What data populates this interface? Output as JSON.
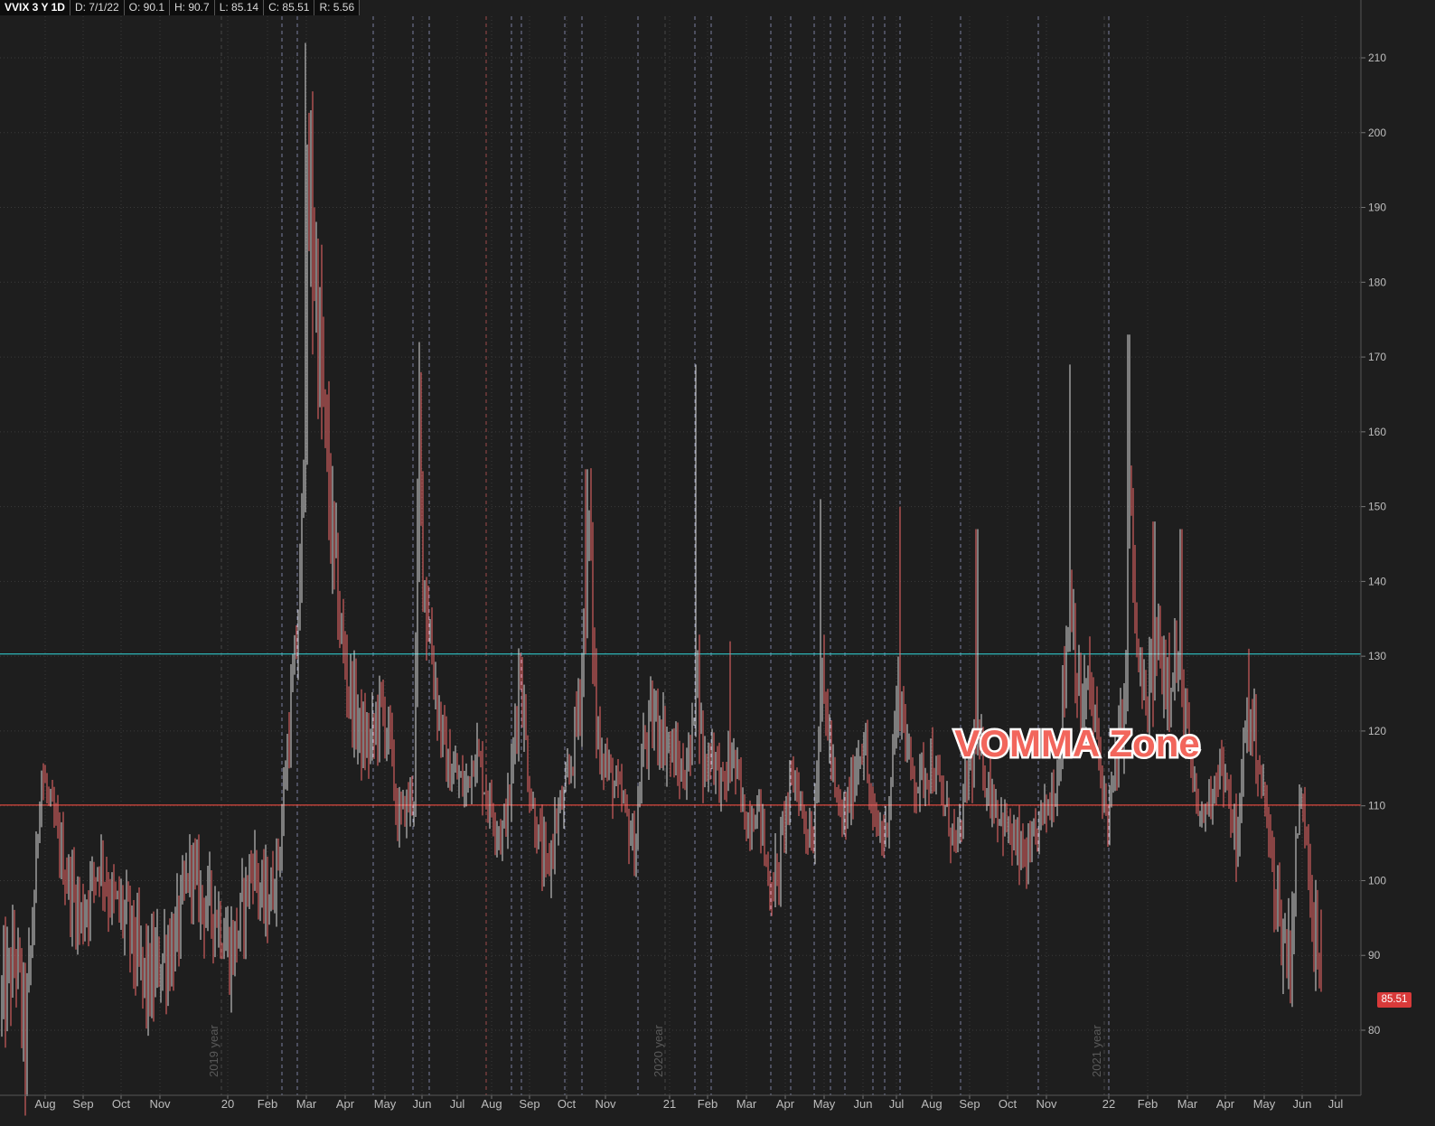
{
  "header": {
    "symbol": "VVIX 3 Y 1D",
    "date": "D: 7/1/22",
    "open": "O: 90.1",
    "high": "H: 90.7",
    "low": "L: 85.14",
    "close": "C: 85.51",
    "range": "R: 5.56"
  },
  "price_tag": "85.51",
  "annotation": "VOMMA Zone",
  "colors": {
    "background": "#1e1e1e",
    "down_candle": "#f46b6b",
    "up_candle": "#dcdcdc",
    "upper_line": "#2fc4c8",
    "lower_line": "#d9483f",
    "annotation_fill": "#f2665c",
    "annotation_outline": "#ffffff"
  },
  "chart_data": {
    "type": "candlestick",
    "title": "VVIX 3 Y 1D",
    "ylim": [
      72,
      215
    ],
    "yticks": [
      80,
      90,
      100,
      110,
      120,
      130,
      140,
      150,
      160,
      170,
      180,
      190,
      200,
      210
    ],
    "x_tick_labels": [
      "Aug",
      "Sep",
      "Oct",
      "Nov",
      "20",
      "Feb",
      "Mar",
      "Apr",
      "May",
      "Jun",
      "Jul",
      "Aug",
      "Sep",
      "Oct",
      "Nov",
      "21",
      "Feb",
      "Mar",
      "Apr",
      "May",
      "Jun",
      "Jul",
      "Aug",
      "Sep",
      "Oct",
      "Nov",
      "22",
      "Feb",
      "Mar",
      "Apr",
      "May",
      "Jun",
      "Jul"
    ],
    "year_labels": [
      "2019 year",
      "2020 year",
      "2021 year"
    ],
    "horizontal_lines": [
      {
        "value": 130.3,
        "color": "#2fc4c8"
      },
      {
        "value": 110.1,
        "color": "#d9483f"
      }
    ],
    "grid": true,
    "last_close": 85.51,
    "series_anchor_points": [
      [
        0,
        83
      ],
      [
        18,
        90
      ],
      [
        28,
        78
      ],
      [
        40,
        102
      ],
      [
        45,
        115
      ],
      [
        55,
        110
      ],
      [
        65,
        105
      ],
      [
        75,
        100
      ],
      [
        90,
        95
      ],
      [
        110,
        103
      ],
      [
        125,
        97
      ],
      [
        140,
        95
      ],
      [
        155,
        88
      ],
      [
        165,
        86
      ],
      [
        180,
        90
      ],
      [
        195,
        92
      ],
      [
        210,
        102
      ],
      [
        225,
        97
      ],
      [
        240,
        96
      ],
      [
        255,
        90
      ],
      [
        265,
        94
      ],
      [
        280,
        103
      ],
      [
        290,
        97
      ],
      [
        300,
        98
      ],
      [
        310,
        105
      ],
      [
        318,
        118
      ],
      [
        326,
        128
      ],
      [
        333,
        140
      ],
      [
        338,
        175
      ],
      [
        343,
        190
      ],
      [
        348,
        184
      ],
      [
        355,
        168
      ],
      [
        362,
        155
      ],
      [
        370,
        142
      ],
      [
        380,
        130
      ],
      [
        390,
        124
      ],
      [
        400,
        119
      ],
      [
        410,
        118
      ],
      [
        420,
        123
      ],
      [
        430,
        120
      ],
      [
        440,
        108
      ],
      [
        450,
        110
      ],
      [
        458,
        112
      ],
      [
        464,
        158
      ],
      [
        470,
        140
      ],
      [
        478,
        130
      ],
      [
        486,
        122
      ],
      [
        495,
        115
      ],
      [
        505,
        114
      ],
      [
        515,
        112
      ],
      [
        525,
        118
      ],
      [
        540,
        111
      ],
      [
        555,
        106
      ],
      [
        565,
        112
      ],
      [
        575,
        130
      ],
      [
        585,
        113
      ],
      [
        595,
        106
      ],
      [
        605,
        100
      ],
      [
        615,
        108
      ],
      [
        625,
        111
      ],
      [
        635,
        118
      ],
      [
        645,
        130
      ],
      [
        652,
        148
      ],
      [
        660,
        120
      ],
      [
        675,
        114
      ],
      [
        690,
        110
      ],
      [
        702,
        104
      ],
      [
        712,
        118
      ],
      [
        725,
        122
      ],
      [
        740,
        118
      ],
      [
        755,
        114
      ],
      [
        766,
        118
      ],
      [
        770,
        132
      ],
      [
        778,
        115
      ],
      [
        788,
        118
      ],
      [
        800,
        112
      ],
      [
        810,
        117
      ],
      [
        825,
        108
      ],
      [
        840,
        110
      ],
      [
        850,
        100
      ],
      [
        860,
        100
      ],
      [
        870,
        110
      ],
      [
        880,
        114
      ],
      [
        890,
        108
      ],
      [
        900,
        106
      ],
      [
        908,
        126
      ],
      [
        915,
        122
      ],
      [
        925,
        110
      ],
      [
        935,
        108
      ],
      [
        945,
        114
      ],
      [
        955,
        120
      ],
      [
        965,
        108
      ],
      [
        980,
        106
      ],
      [
        995,
        127
      ],
      [
        1005,
        116
      ],
      [
        1015,
        113
      ],
      [
        1030,
        116
      ],
      [
        1045,
        110
      ],
      [
        1060,
        104
      ],
      [
        1070,
        114
      ],
      [
        1082,
        118
      ],
      [
        1095,
        112
      ],
      [
        1110,
        108
      ],
      [
        1125,
        104
      ],
      [
        1140,
        102
      ],
      [
        1150,
        108
      ],
      [
        1160,
        110
      ],
      [
        1170,
        114
      ],
      [
        1178,
        128
      ],
      [
        1185,
        140
      ],
      [
        1195,
        122
      ],
      [
        1205,
        126
      ],
      [
        1215,
        118
      ],
      [
        1225,
        108
      ],
      [
        1235,
        115
      ],
      [
        1245,
        124
      ],
      [
        1250,
        153
      ],
      [
        1258,
        130
      ],
      [
        1268,
        122
      ],
      [
        1280,
        132
      ],
      [
        1290,
        128
      ],
      [
        1300,
        130
      ],
      [
        1310,
        124
      ],
      [
        1320,
        112
      ],
      [
        1330,
        108
      ],
      [
        1340,
        112
      ],
      [
        1350,
        116
      ],
      [
        1360,
        110
      ],
      [
        1370,
        104
      ],
      [
        1378,
        122
      ],
      [
        1388,
        120
      ],
      [
        1395,
        114
      ],
      [
        1402,
        108
      ],
      [
        1410,
        100
      ],
      [
        1420,
        92
      ],
      [
        1428,
        90
      ],
      [
        1436,
        108
      ],
      [
        1442,
        111
      ],
      [
        1448,
        104
      ],
      [
        1455,
        92
      ],
      [
        1463,
        86
      ]
    ]
  }
}
